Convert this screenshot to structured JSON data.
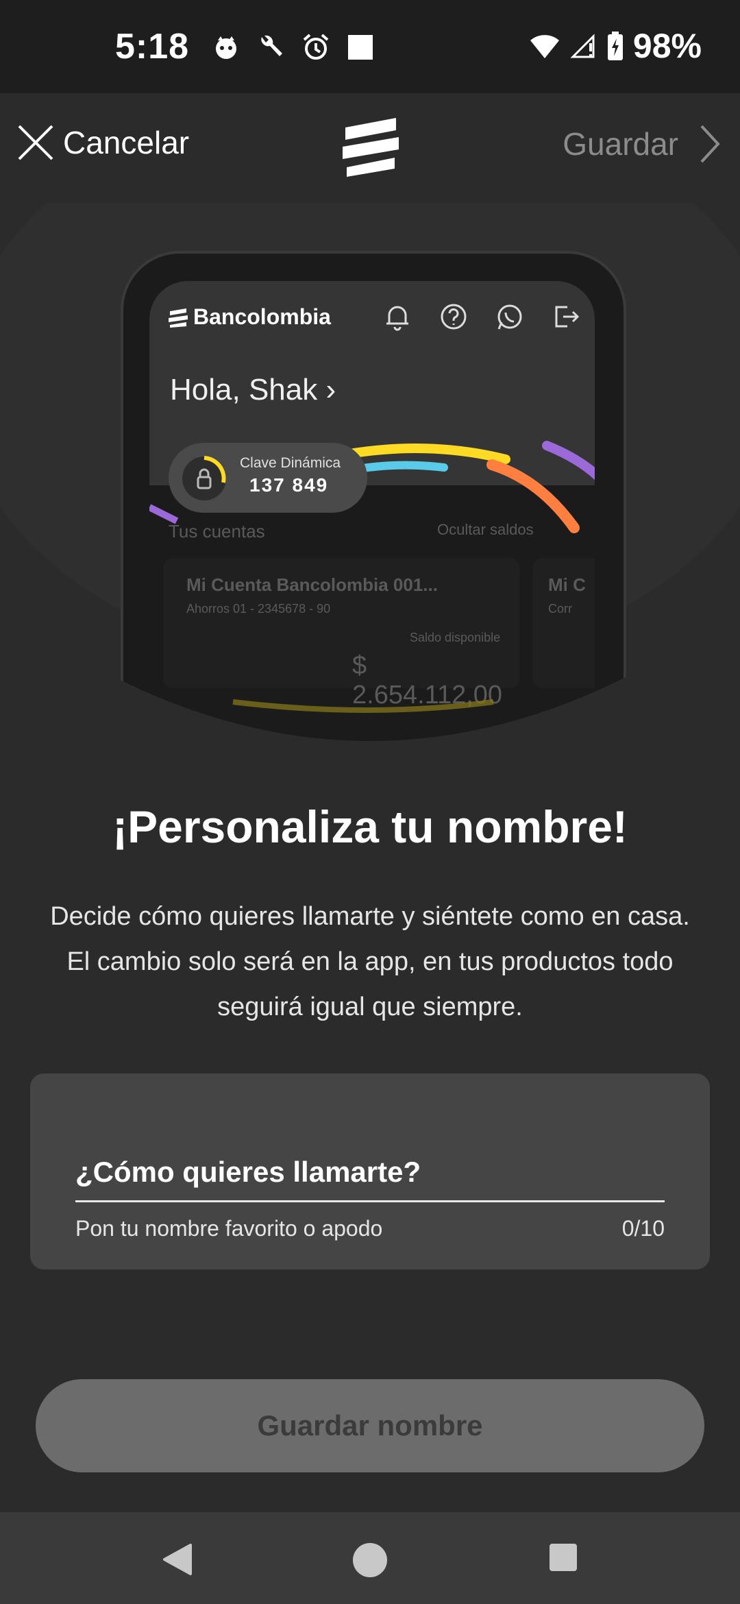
{
  "status_bar": {
    "time": "5:18",
    "battery": "98%",
    "icons": [
      "cat-icon",
      "wrench-icon",
      "alarm-icon",
      "square-icon",
      "wifi-icon",
      "signal-icon",
      "battery-icon"
    ]
  },
  "header": {
    "cancel_label": "Cancelar",
    "save_label": "Guardar"
  },
  "hero": {
    "brand": "Bancolombia",
    "greeting": "Hola, Shak",
    "clave_label": "Clave Dinámica",
    "clave_code": "137  849",
    "accounts_label": "Tus cuentas",
    "hide_balances": "Ocultar saldos",
    "account_name": "Mi Cuenta Bancolombia 001...",
    "account_number": "Ahorros 01 - 2345678 - 90",
    "balance_label": "Saldo disponible",
    "balance": "$ 2.654.112,00",
    "account2_short": "Mi C",
    "account2_sub": "Corr"
  },
  "main": {
    "title": "¡Personaliza tu nombre!",
    "description": "Decide cómo quieres llamarte y siéntete como en casa. El cambio solo será en la app, en tus productos todo seguirá igual que siempre.",
    "input_label": "¿Cómo quieres llamarte?",
    "helper_text": "Pon tu nombre favorito o apodo",
    "counter": "0/10",
    "button_label": "Guardar nombre"
  },
  "colors": {
    "background": "#2b2b2c",
    "status_bar": "#1e1e1f",
    "card": "#454546",
    "button_disabled": "#6c6c6d",
    "accent_yellow": "#fdda24",
    "accent_orange": "#ff7f41",
    "accent_blue": "#59cbe8",
    "accent_purple": "#9c6ad8",
    "accent_green": "#00c389"
  }
}
